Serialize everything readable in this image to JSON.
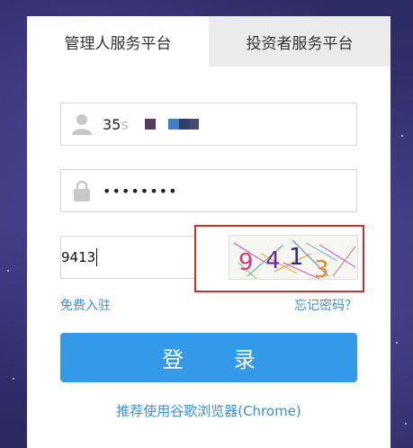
{
  "tabs": [
    {
      "label": "管理人服务平台",
      "active": true
    },
    {
      "label": "投资者服务平台",
      "active": false
    }
  ],
  "username": {
    "value_visible": "35",
    "icon": "user-icon"
  },
  "password": {
    "value": "••••••••",
    "icon": "lock-icon"
  },
  "captcha": {
    "input_value": "9413",
    "image_chars": [
      "9",
      "4",
      "1",
      "3"
    ]
  },
  "links": {
    "register": "免费入驻",
    "forgot": "忘记密码？"
  },
  "login_button": "登 录",
  "browser_tip": "推荐使用谷歌浏览器(Chrome)",
  "colors": {
    "accent": "#3399e8",
    "highlight_border": "#c9302c",
    "link": "#3a8fd9"
  }
}
